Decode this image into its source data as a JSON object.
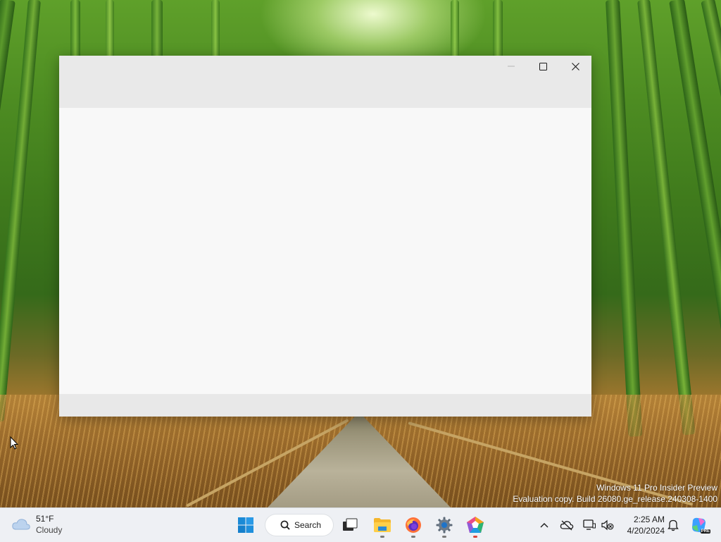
{
  "desktop": {
    "watermark_line1": "Windows 11 Pro Insider Preview",
    "watermark_line2": "Evaluation copy. Build 26080.ge_release.240308-1400"
  },
  "window": {
    "title": "",
    "controls": [
      "minimize-icon",
      "maximize-icon",
      "close-icon"
    ]
  },
  "taskbar": {
    "weather": {
      "temp": "51°F",
      "condition": "Cloudy",
      "icon": "cloud-icon"
    },
    "search": {
      "label": "Search",
      "icon": "search-icon"
    },
    "apps": [
      {
        "name": "start",
        "icon": "windows-logo-icon"
      },
      {
        "name": "task-view",
        "icon": "task-view-icon"
      },
      {
        "name": "file-explorer",
        "icon": "folder-icon",
        "running": true
      },
      {
        "name": "firefox",
        "icon": "firefox-icon",
        "running": true
      },
      {
        "name": "settings",
        "icon": "gear-icon",
        "running": true
      },
      {
        "name": "copilot-app",
        "icon": "app-icon",
        "running": true
      }
    ],
    "tray": [
      "chevron-up-icon",
      "onedrive-offline-icon",
      "display-icon",
      "volume-muted-icon"
    ],
    "clock": {
      "time": "2:25 AM",
      "date": "4/20/2024"
    },
    "notifications_icon": "bell-icon",
    "copilot_badge": "PRE"
  },
  "colors": {
    "window_bg": "#f7f7f7",
    "titlebar_bg": "#e9e9e9",
    "taskbar_bg": "#eef0f4",
    "accent": "#0078d4"
  }
}
